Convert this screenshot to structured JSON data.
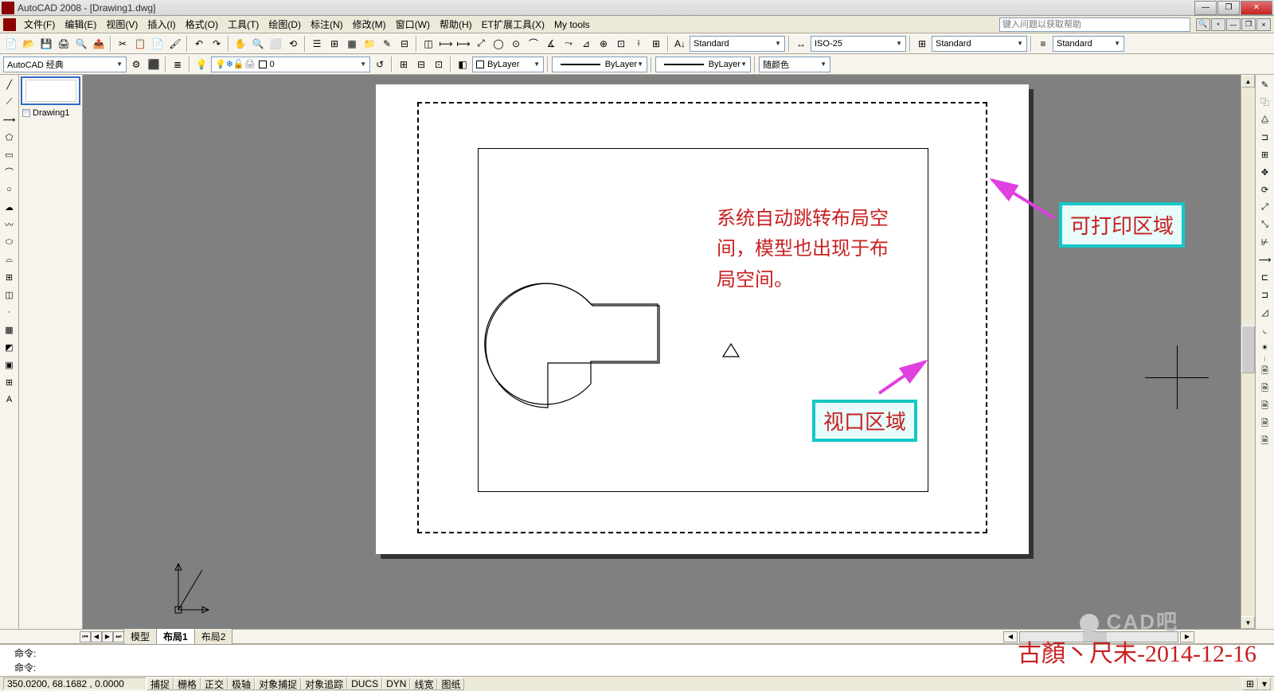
{
  "app": {
    "title": "AutoCAD 2008 - [Drawing1.dwg]"
  },
  "menu": {
    "items": [
      "文件(F)",
      "编辑(E)",
      "视图(V)",
      "插入(I)",
      "格式(O)",
      "工具(T)",
      "绘图(D)",
      "标注(N)",
      "修改(M)",
      "窗口(W)",
      "帮助(H)",
      "ET扩展工具(X)",
      "My tools"
    ],
    "help_placeholder": "键入问题以获取帮助"
  },
  "toolbars": {
    "workspace": "AutoCAD 经典",
    "textstyle": "Standard",
    "dimstyle": "ISO-25",
    "tablestyle": "Standard",
    "mlstyle": "Standard",
    "layer": "0",
    "linecolor": "ByLayer",
    "linetype": "ByLayer",
    "lineweight": "ByLayer",
    "plotstyle": "随颜色"
  },
  "file_tab": "Drawing1",
  "canvas": {
    "red_text_l1": "系统自动跳转布局空",
    "red_text_l2": "间，模型也出现于布",
    "red_text_l3": "局空间。",
    "label_printable": "可打印区域",
    "label_viewport": "视口区域"
  },
  "tabs": {
    "model": "模型",
    "layout1": "布局1",
    "layout2": "布局2"
  },
  "cmd": {
    "prompt1": "命令:",
    "prompt2": "命令:"
  },
  "status": {
    "coords": "350.0200,  68.1682 ,  0.0000",
    "btns": [
      "捕捉",
      "栅格",
      "正交",
      "极轴",
      "对象捕捉",
      "对象追踪",
      "DUCS",
      "DYN",
      "线宽",
      "图纸"
    ]
  },
  "watermark": "古顏丶尺未-2014-12-16",
  "watermark2": "CAD吧"
}
